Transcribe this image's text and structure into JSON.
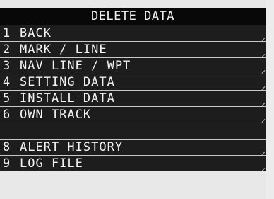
{
  "title": "DELETE DATA",
  "items": [
    {
      "num": "1",
      "label": "BACK"
    },
    {
      "num": "2",
      "label": "MARK / LINE"
    },
    {
      "num": "3",
      "label": "NAV LINE / WPT"
    },
    {
      "num": "4",
      "label": "SETTING DATA"
    },
    {
      "num": "5",
      "label": "INSTALL DATA"
    },
    {
      "num": "6",
      "label": "OWN TRACK"
    },
    {
      "num": "",
      "label": ""
    },
    {
      "num": "8",
      "label": "ALERT HISTORY"
    },
    {
      "num": "9",
      "label": "LOG FILE"
    }
  ],
  "colors": {
    "row_bg": "#1d1d1d",
    "title_bg": "#080808",
    "text": "#f2f2f2",
    "divider": "#c8c8c8"
  }
}
